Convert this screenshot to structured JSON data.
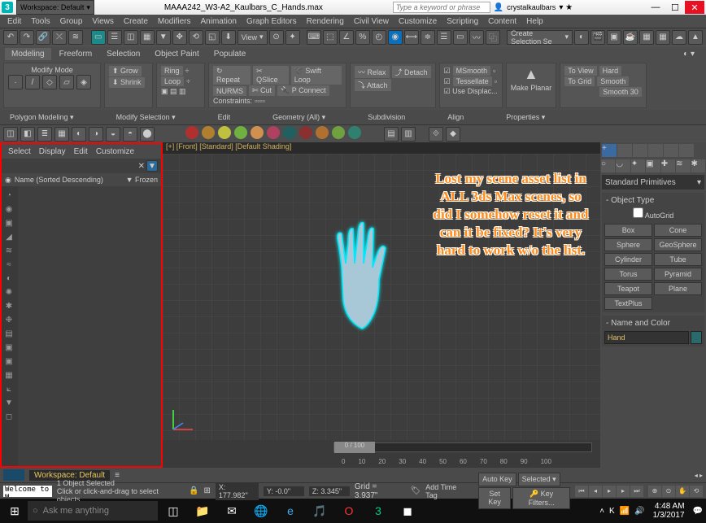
{
  "titlebar": {
    "logo": "3",
    "workspace_dd": "Workspace: Default",
    "filename": "MAAA242_W3-A2_Kaulbars_C_Hands.max",
    "search_placeholder": "Type a keyword or phrase",
    "signin": "crystalkaulbars",
    "min": "—",
    "max": "☐",
    "close": "✕"
  },
  "menubar": [
    "Edit",
    "Tools",
    "Group",
    "Views",
    "Create",
    "Modifiers",
    "Animation",
    "Graph Editors",
    "Rendering",
    "Civil View",
    "Customize",
    "Scripting",
    "Content",
    "Help"
  ],
  "ribbon": {
    "tabs": [
      "Modeling",
      "Freeform",
      "Selection",
      "Object Paint",
      "Populate"
    ],
    "active": 0,
    "modify_mode": "Modify Mode",
    "panels": {
      "grow": "Grow",
      "shrink": "Shrink",
      "ring": "Ring",
      "loop": "Loop",
      "repeat": "Repeat",
      "qslice": "QSlice",
      "swiftloop": "Swift Loop",
      "nurms": "NURMS",
      "cut": "Cut",
      "pconnect": "P Connect",
      "constraints": "Constraints:",
      "relax": "Relax",
      "attach": "Attach",
      "detach": "Detach",
      "msmooth": "MSmooth",
      "tessellate": "Tessellate",
      "usedisp": "Use Displac...",
      "make_planar": "Make Planar",
      "toview": "To View",
      "togrid": "To Grid",
      "hard": "Hard",
      "smooth": "Smooth",
      "smooth30": "Smooth 30"
    },
    "footer": [
      "Polygon Modeling ▾",
      "Modify Selection ▾",
      "Edit",
      "Geometry (All) ▾",
      "Subdivision",
      "Align",
      "Properties ▾"
    ]
  },
  "toolbar": {
    "view_dd": "View",
    "create_sel": "Create Selection Se"
  },
  "quickballs": [
    "#b03030",
    "#b08030",
    "#c0c040",
    "#70b040",
    "#d09050",
    "#b04060",
    "#206060",
    "#8a3030",
    "#b07030",
    "#70a040",
    "#308070"
  ],
  "scene": {
    "menu": [
      "Select",
      "Display",
      "Edit",
      "Customize"
    ],
    "sort_label": "Name (Sorted Descending)",
    "col2": "Frozen",
    "icons": [
      "◔",
      "◉",
      "▣",
      "◢",
      "≋",
      "≈",
      "◐",
      "✺",
      "✱",
      "❉",
      "▤",
      "▣",
      "▣",
      "▦",
      "⟀",
      "▼",
      "◻"
    ]
  },
  "viewport": {
    "label": "[+] [Front] [Standard] [Default Shading]",
    "overlay": "Lost my scene asset list in ALL 3ds Max scenes, so did I somehow reset it and can it be fixed? It's very hard to work w/o the list.",
    "slider_handle": "0 / 100",
    "ruler": [
      "0",
      "10",
      "20",
      "30",
      "40",
      "50",
      "60",
      "70",
      "80",
      "90",
      "100"
    ]
  },
  "rightpanel": {
    "dd": "Standard Primitives",
    "obj_type_h": "- Object Type",
    "autogrid": "AutoGrid",
    "btns": [
      "Box",
      "Cone",
      "Sphere",
      "GeoSphere",
      "Cylinder",
      "Tube",
      "Torus",
      "Pyramid",
      "Teapot",
      "Plane",
      "TextPlus"
    ],
    "name_color_h": "- Name and Color",
    "name_value": "Hand"
  },
  "bottom": {
    "workspace": "Workspace: Default",
    "sel_count": "1 Object Selected",
    "hint": "Click or click-and-drag to select objects",
    "welcome": "Welcome to M",
    "x": "X: 177.982\"",
    "y": "Y: -0.0\"",
    "z": "Z: 3.345\"",
    "grid": "Grid = 3.937\"",
    "addtag": "Add Time Tag",
    "autokey": "Auto Key",
    "setkey": "Set Key",
    "selected_dd": "Selected",
    "keyfilters": "Key Filters..."
  },
  "taskbar": {
    "cortana": "Ask me anything",
    "apps": [
      "⊞",
      "📁",
      "✉",
      "🌐",
      "e",
      "🎵",
      "🔴",
      "🟢",
      "⬛"
    ],
    "time": "4:48 AM",
    "date": "1/3/2017"
  }
}
